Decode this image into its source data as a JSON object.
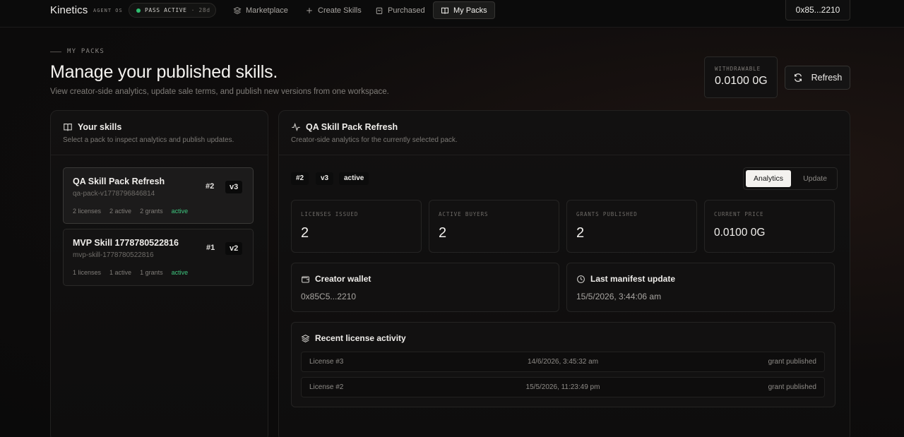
{
  "nav": {
    "brand": "Kinetics",
    "brand_sub": "AGENT OS",
    "pass_label": "PASS ACTIVE",
    "pass_days": "· 28d",
    "items": [
      {
        "label": "Marketplace",
        "icon": "layers-icon"
      },
      {
        "label": "Create Skills",
        "icon": "plus-icon"
      },
      {
        "label": "Purchased",
        "icon": "bag-icon"
      },
      {
        "label": "My Packs",
        "icon": "book-icon",
        "active": true
      }
    ],
    "wallet": "0x85...2210"
  },
  "header": {
    "eyebrow": "MY PACKS",
    "title": "Manage your published skills.",
    "subtitle": "View creator-side analytics, update sale terms, and publish new versions from one workspace.",
    "withdrawable_label": "WITHDRAWABLE",
    "withdrawable_value": "0.0100 0G",
    "refresh_label": "Refresh"
  },
  "skills_panel": {
    "title": "Your skills",
    "subtitle": "Select a pack to inspect analytics and publish updates.",
    "skills": [
      {
        "name": "QA Skill Pack Refresh",
        "slug": "qa-pack-v1778796846814",
        "num": "#2",
        "version": "v3",
        "licenses": "2 licenses",
        "active": "2 active",
        "grants": "2 grants",
        "status": "active",
        "selected": true
      },
      {
        "name": "MVP Skill 1778780522816",
        "slug": "mvp-skill-1778780522816",
        "num": "#1",
        "version": "v2",
        "licenses": "1 licenses",
        "active": "1 active",
        "grants": "1 grants",
        "status": "active",
        "selected": false
      }
    ]
  },
  "detail": {
    "title": "QA Skill Pack Refresh",
    "subtitle": "Creator-side analytics for the currently selected pack.",
    "tags": [
      "#2",
      "v3",
      "active"
    ],
    "tabs": {
      "analytics": "Analytics",
      "update": "Update"
    },
    "stats": [
      {
        "label": "LICENSES ISSUED",
        "value": "2"
      },
      {
        "label": "ACTIVE BUYERS",
        "value": "2"
      },
      {
        "label": "GRANTS PUBLISHED",
        "value": "2"
      },
      {
        "label": "CURRENT PRICE",
        "value": "0.0100 0G"
      }
    ],
    "creator_wallet_label": "Creator wallet",
    "creator_wallet_value": "0x85C5...2210",
    "manifest_label": "Last manifest update",
    "manifest_value": "15/5/2026, 3:44:06 am",
    "activity_title": "Recent license activity",
    "activity": [
      {
        "license": "License #3",
        "time": "14/6/2026, 3:45:32 am",
        "status": "grant published"
      },
      {
        "license": "License #2",
        "time": "15/5/2026, 11:23:49 pm",
        "status": "grant published"
      }
    ]
  }
}
